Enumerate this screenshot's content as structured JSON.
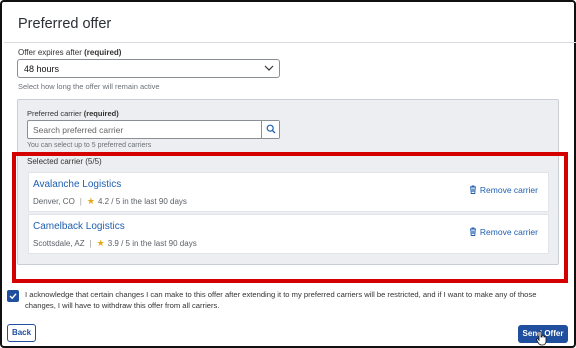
{
  "header": {
    "title": "Preferred offer"
  },
  "expiry": {
    "label": "Offer expires after",
    "required": "(required)",
    "value": "48 hours",
    "help": "Select how long the offer will remain active"
  },
  "preferred_carrier": {
    "label": "Preferred carrier",
    "required": "(required)",
    "placeholder": "Search preferred carrier",
    "help": "You can select up to 5 preferred carriers"
  },
  "selected": {
    "label": "Selected carrier (5/5)",
    "carriers": [
      {
        "name": "Avalanche Logistics",
        "location": "Denver, CO",
        "rating": "4.2 / 5 in the last 90 days",
        "remove_label": "Remove carrier"
      },
      {
        "name": "Camelback Logistics",
        "location": "Scottsdale, AZ",
        "rating": "3.9 / 5 in the last 90 days",
        "remove_label": "Remove carrier"
      }
    ]
  },
  "acknowledgement": {
    "checked": true,
    "text": "I acknowledge that certain changes I can make to this offer after extending it to my preferred carriers will be restricted, and if I want to make any of those changes, I will have to withdraw this offer from all carriers."
  },
  "footer": {
    "back_label": "Back",
    "send_label": "Send Offer"
  },
  "colors": {
    "accent": "#1f4f9e",
    "link": "#1f5fb0",
    "highlight": "#d40000",
    "star": "#e6a817"
  },
  "icons": [
    "chevron-down-icon",
    "search-icon",
    "star-icon",
    "trash-icon",
    "checkmark-icon",
    "pointer-cursor-icon"
  ]
}
